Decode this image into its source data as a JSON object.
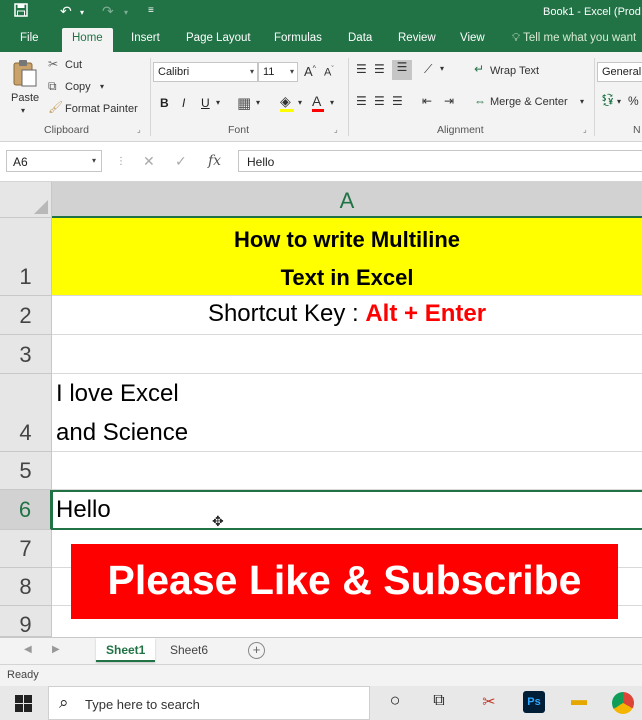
{
  "window": {
    "title": "Book1 - Excel (Prod"
  },
  "quick_access": {
    "save_icon": "save-icon",
    "undo_icon": "undo-icon",
    "redo_icon": "redo-icon",
    "customize_icon": "customize-icon"
  },
  "ribbon_tabs": [
    "File",
    "Home",
    "Insert",
    "Page Layout",
    "Formulas",
    "Data",
    "Review",
    "View"
  ],
  "tell_me": "Tell me what you want",
  "clipboard": {
    "paste": "Paste",
    "cut": "Cut",
    "copy": "Copy",
    "format_painter": "Format Painter",
    "label": "Clipboard"
  },
  "font": {
    "name": "Calibri",
    "size": "11",
    "bold": "B",
    "italic": "I",
    "underline": "U",
    "label": "Font"
  },
  "alignment": {
    "wrap_text": "Wrap Text",
    "merge_center": "Merge & Center",
    "label": "Alignment"
  },
  "number": {
    "format": "General",
    "label": "N"
  },
  "formula_bar": {
    "name_box": "A6",
    "cancel": "✕",
    "enter": "✓",
    "fx": "fx",
    "value": "Hello"
  },
  "grid": {
    "column_header": "A",
    "rows": [
      "1",
      "2",
      "3",
      "4",
      "5",
      "6",
      "7",
      "8",
      "9"
    ],
    "r1_line1": "How to write Multiline",
    "r1_line2": "Text in Excel",
    "r2_prefix": "Shortcut Key : ",
    "r2_key": "Alt + Enter",
    "r4_line1": "I love Excel",
    "r4_line2": "and Science",
    "r6": "Hello"
  },
  "banner": {
    "text": "Please Like & Subscribe"
  },
  "sheets": [
    {
      "name": "Sheet1",
      "active": true
    },
    {
      "name": "Sheet6",
      "active": false
    }
  ],
  "status": {
    "text": "Ready"
  },
  "taskbar": {
    "search_placeholder": "Type here to search"
  },
  "colors": {
    "excel_green": "#217346",
    "highlight_yellow": "#ffff00",
    "banner_red": "#ff0000"
  }
}
